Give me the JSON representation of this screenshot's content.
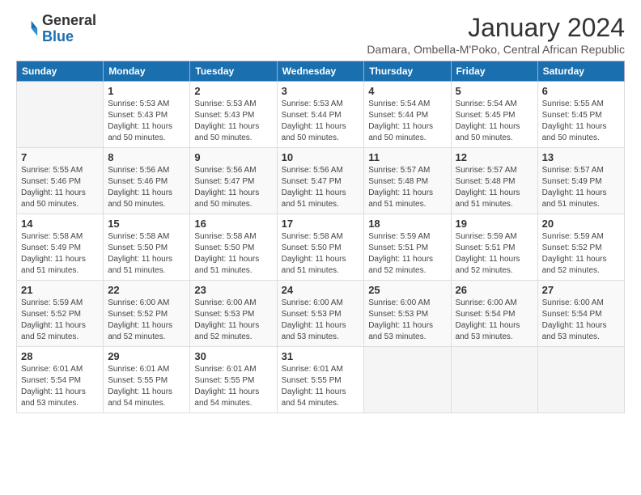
{
  "logo": {
    "general": "General",
    "blue": "Blue"
  },
  "title": "January 2024",
  "subtitle": "Damara, Ombella-M'Poko, Central African Republic",
  "days_of_week": [
    "Sunday",
    "Monday",
    "Tuesday",
    "Wednesday",
    "Thursday",
    "Friday",
    "Saturday"
  ],
  "weeks": [
    [
      {
        "day": "",
        "info": ""
      },
      {
        "day": "1",
        "info": "Sunrise: 5:53 AM\nSunset: 5:43 PM\nDaylight: 11 hours\nand 50 minutes."
      },
      {
        "day": "2",
        "info": "Sunrise: 5:53 AM\nSunset: 5:43 PM\nDaylight: 11 hours\nand 50 minutes."
      },
      {
        "day": "3",
        "info": "Sunrise: 5:53 AM\nSunset: 5:44 PM\nDaylight: 11 hours\nand 50 minutes."
      },
      {
        "day": "4",
        "info": "Sunrise: 5:54 AM\nSunset: 5:44 PM\nDaylight: 11 hours\nand 50 minutes."
      },
      {
        "day": "5",
        "info": "Sunrise: 5:54 AM\nSunset: 5:45 PM\nDaylight: 11 hours\nand 50 minutes."
      },
      {
        "day": "6",
        "info": "Sunrise: 5:55 AM\nSunset: 5:45 PM\nDaylight: 11 hours\nand 50 minutes."
      }
    ],
    [
      {
        "day": "7",
        "info": "Sunrise: 5:55 AM\nSunset: 5:46 PM\nDaylight: 11 hours\nand 50 minutes."
      },
      {
        "day": "8",
        "info": "Sunrise: 5:56 AM\nSunset: 5:46 PM\nDaylight: 11 hours\nand 50 minutes."
      },
      {
        "day": "9",
        "info": "Sunrise: 5:56 AM\nSunset: 5:47 PM\nDaylight: 11 hours\nand 50 minutes."
      },
      {
        "day": "10",
        "info": "Sunrise: 5:56 AM\nSunset: 5:47 PM\nDaylight: 11 hours\nand 51 minutes."
      },
      {
        "day": "11",
        "info": "Sunrise: 5:57 AM\nSunset: 5:48 PM\nDaylight: 11 hours\nand 51 minutes."
      },
      {
        "day": "12",
        "info": "Sunrise: 5:57 AM\nSunset: 5:48 PM\nDaylight: 11 hours\nand 51 minutes."
      },
      {
        "day": "13",
        "info": "Sunrise: 5:57 AM\nSunset: 5:49 PM\nDaylight: 11 hours\nand 51 minutes."
      }
    ],
    [
      {
        "day": "14",
        "info": "Sunrise: 5:58 AM\nSunset: 5:49 PM\nDaylight: 11 hours\nand 51 minutes."
      },
      {
        "day": "15",
        "info": "Sunrise: 5:58 AM\nSunset: 5:50 PM\nDaylight: 11 hours\nand 51 minutes."
      },
      {
        "day": "16",
        "info": "Sunrise: 5:58 AM\nSunset: 5:50 PM\nDaylight: 11 hours\nand 51 minutes."
      },
      {
        "day": "17",
        "info": "Sunrise: 5:58 AM\nSunset: 5:50 PM\nDaylight: 11 hours\nand 51 minutes."
      },
      {
        "day": "18",
        "info": "Sunrise: 5:59 AM\nSunset: 5:51 PM\nDaylight: 11 hours\nand 52 minutes."
      },
      {
        "day": "19",
        "info": "Sunrise: 5:59 AM\nSunset: 5:51 PM\nDaylight: 11 hours\nand 52 minutes."
      },
      {
        "day": "20",
        "info": "Sunrise: 5:59 AM\nSunset: 5:52 PM\nDaylight: 11 hours\nand 52 minutes."
      }
    ],
    [
      {
        "day": "21",
        "info": "Sunrise: 5:59 AM\nSunset: 5:52 PM\nDaylight: 11 hours\nand 52 minutes."
      },
      {
        "day": "22",
        "info": "Sunrise: 6:00 AM\nSunset: 5:52 PM\nDaylight: 11 hours\nand 52 minutes."
      },
      {
        "day": "23",
        "info": "Sunrise: 6:00 AM\nSunset: 5:53 PM\nDaylight: 11 hours\nand 52 minutes."
      },
      {
        "day": "24",
        "info": "Sunrise: 6:00 AM\nSunset: 5:53 PM\nDaylight: 11 hours\nand 53 minutes."
      },
      {
        "day": "25",
        "info": "Sunrise: 6:00 AM\nSunset: 5:53 PM\nDaylight: 11 hours\nand 53 minutes."
      },
      {
        "day": "26",
        "info": "Sunrise: 6:00 AM\nSunset: 5:54 PM\nDaylight: 11 hours\nand 53 minutes."
      },
      {
        "day": "27",
        "info": "Sunrise: 6:00 AM\nSunset: 5:54 PM\nDaylight: 11 hours\nand 53 minutes."
      }
    ],
    [
      {
        "day": "28",
        "info": "Sunrise: 6:01 AM\nSunset: 5:54 PM\nDaylight: 11 hours\nand 53 minutes."
      },
      {
        "day": "29",
        "info": "Sunrise: 6:01 AM\nSunset: 5:55 PM\nDaylight: 11 hours\nand 54 minutes."
      },
      {
        "day": "30",
        "info": "Sunrise: 6:01 AM\nSunset: 5:55 PM\nDaylight: 11 hours\nand 54 minutes."
      },
      {
        "day": "31",
        "info": "Sunrise: 6:01 AM\nSunset: 5:55 PM\nDaylight: 11 hours\nand 54 minutes."
      },
      {
        "day": "",
        "info": ""
      },
      {
        "day": "",
        "info": ""
      },
      {
        "day": "",
        "info": ""
      }
    ]
  ]
}
